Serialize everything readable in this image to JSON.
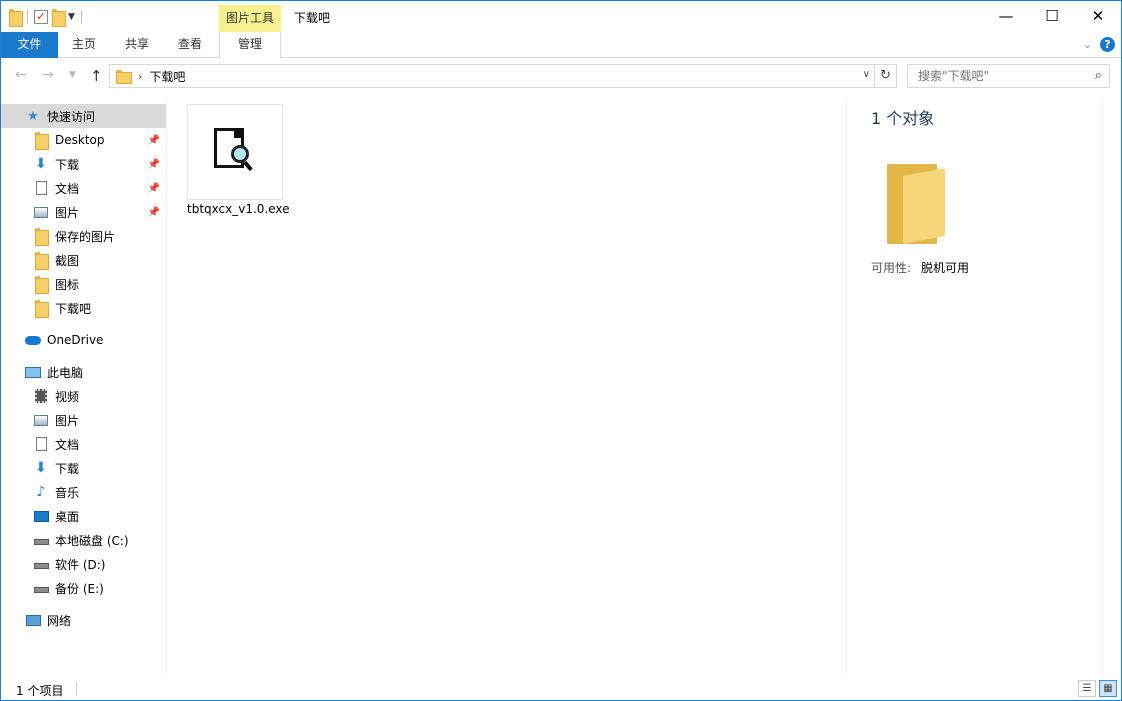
{
  "title_bar": {
    "context_tab": "图片工具",
    "window_title": "下载吧",
    "minimize": "—",
    "maximize": "☐",
    "close": "✕"
  },
  "quick_access_toolbar": {
    "icons": [
      "folder-icon",
      "properties-icon",
      "new-folder-icon",
      "customize-dropdown-icon"
    ]
  },
  "ribbon": {
    "tabs": [
      {
        "label": "文件"
      },
      {
        "label": "主页"
      },
      {
        "label": "共享"
      },
      {
        "label": "查看"
      },
      {
        "label": "管理"
      }
    ],
    "help": "?"
  },
  "address_bar": {
    "breadcrumb": [
      "下载吧"
    ],
    "search_placeholder": "搜索\"下载吧\""
  },
  "nav_pane": {
    "quick_access": {
      "label": "快速访问"
    },
    "quick_items": [
      {
        "label": "Desktop",
        "icon": "folder-icon",
        "pinned": true
      },
      {
        "label": "下载",
        "icon": "download-icon",
        "pinned": true
      },
      {
        "label": "文档",
        "icon": "document-icon",
        "pinned": true
      },
      {
        "label": "图片",
        "icon": "picture-icon",
        "pinned": true
      },
      {
        "label": "保存的图片",
        "icon": "folder-icon",
        "pinned": false
      },
      {
        "label": "截图",
        "icon": "folder-icon",
        "pinned": false
      },
      {
        "label": "图标",
        "icon": "folder-icon",
        "pinned": false
      },
      {
        "label": "下载吧",
        "icon": "folder-icon",
        "pinned": false
      }
    ],
    "onedrive": {
      "label": "OneDrive"
    },
    "this_pc": {
      "label": "此电脑"
    },
    "pc_items": [
      {
        "label": "视频",
        "icon": "video-icon"
      },
      {
        "label": "图片",
        "icon": "picture-icon"
      },
      {
        "label": "文档",
        "icon": "document-icon"
      },
      {
        "label": "下载",
        "icon": "download-icon"
      },
      {
        "label": "音乐",
        "icon": "music-icon"
      },
      {
        "label": "桌面",
        "icon": "desktop-icon"
      },
      {
        "label": "本地磁盘 (C:)",
        "icon": "drive-c-icon"
      },
      {
        "label": "软件 (D:)",
        "icon": "drive-icon"
      },
      {
        "label": "备份 (E:)",
        "icon": "drive-icon"
      }
    ],
    "network": {
      "label": "网络"
    }
  },
  "content": {
    "files": [
      {
        "name": "tbtqxcx_v1.0.exe",
        "icon": "exe-search-icon"
      }
    ]
  },
  "details_pane": {
    "title": "1 个对象",
    "availability_label": "可用性:",
    "availability_value": "脱机可用"
  },
  "status_bar": {
    "item_count": "1 个项目"
  },
  "colors": {
    "accent": "#1979ca",
    "context_tab_bg": "#f7f08e",
    "selected_bg": "#d9d9d9",
    "folder": "#f6cf66"
  }
}
